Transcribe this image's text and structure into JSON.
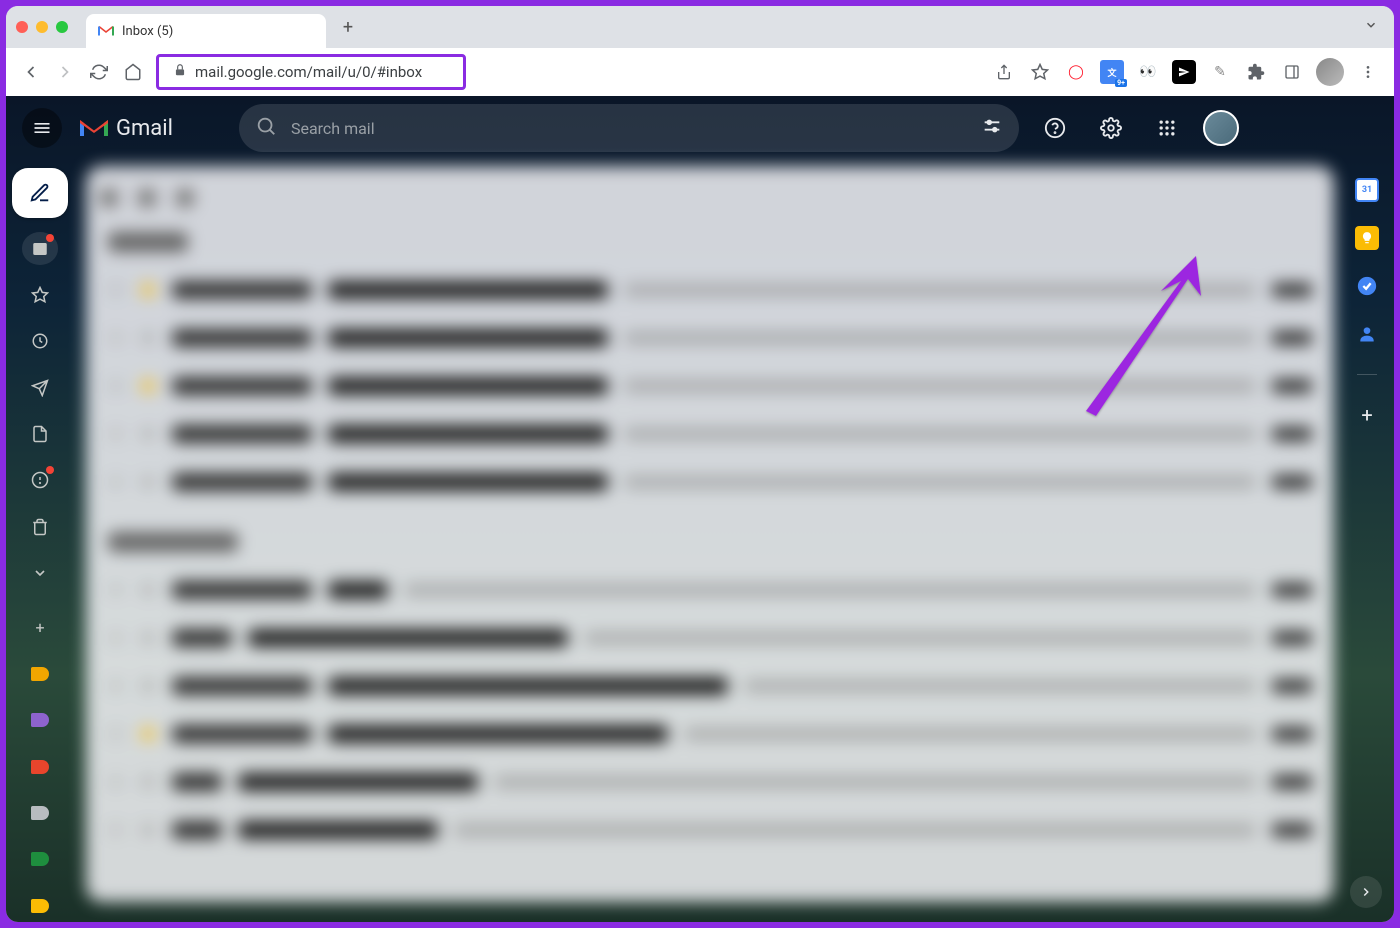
{
  "browser": {
    "tab_title": "Inbox (5)",
    "url": "mail.google.com/mail/u/0/#inbox"
  },
  "gmail": {
    "product_name": "Gmail",
    "search_placeholder": "Search mail"
  },
  "annotation": {
    "target": "settings-gear"
  },
  "sidepanel_apps": {
    "calendar": "Calendar",
    "keep": "Keep",
    "tasks": "Tasks",
    "contacts": "Contacts"
  },
  "label_colors": [
    "#f2a600",
    "#8e63ce",
    "#e8452c",
    "#b8bcc0",
    "#1e8e3e",
    "#fbbc04"
  ]
}
